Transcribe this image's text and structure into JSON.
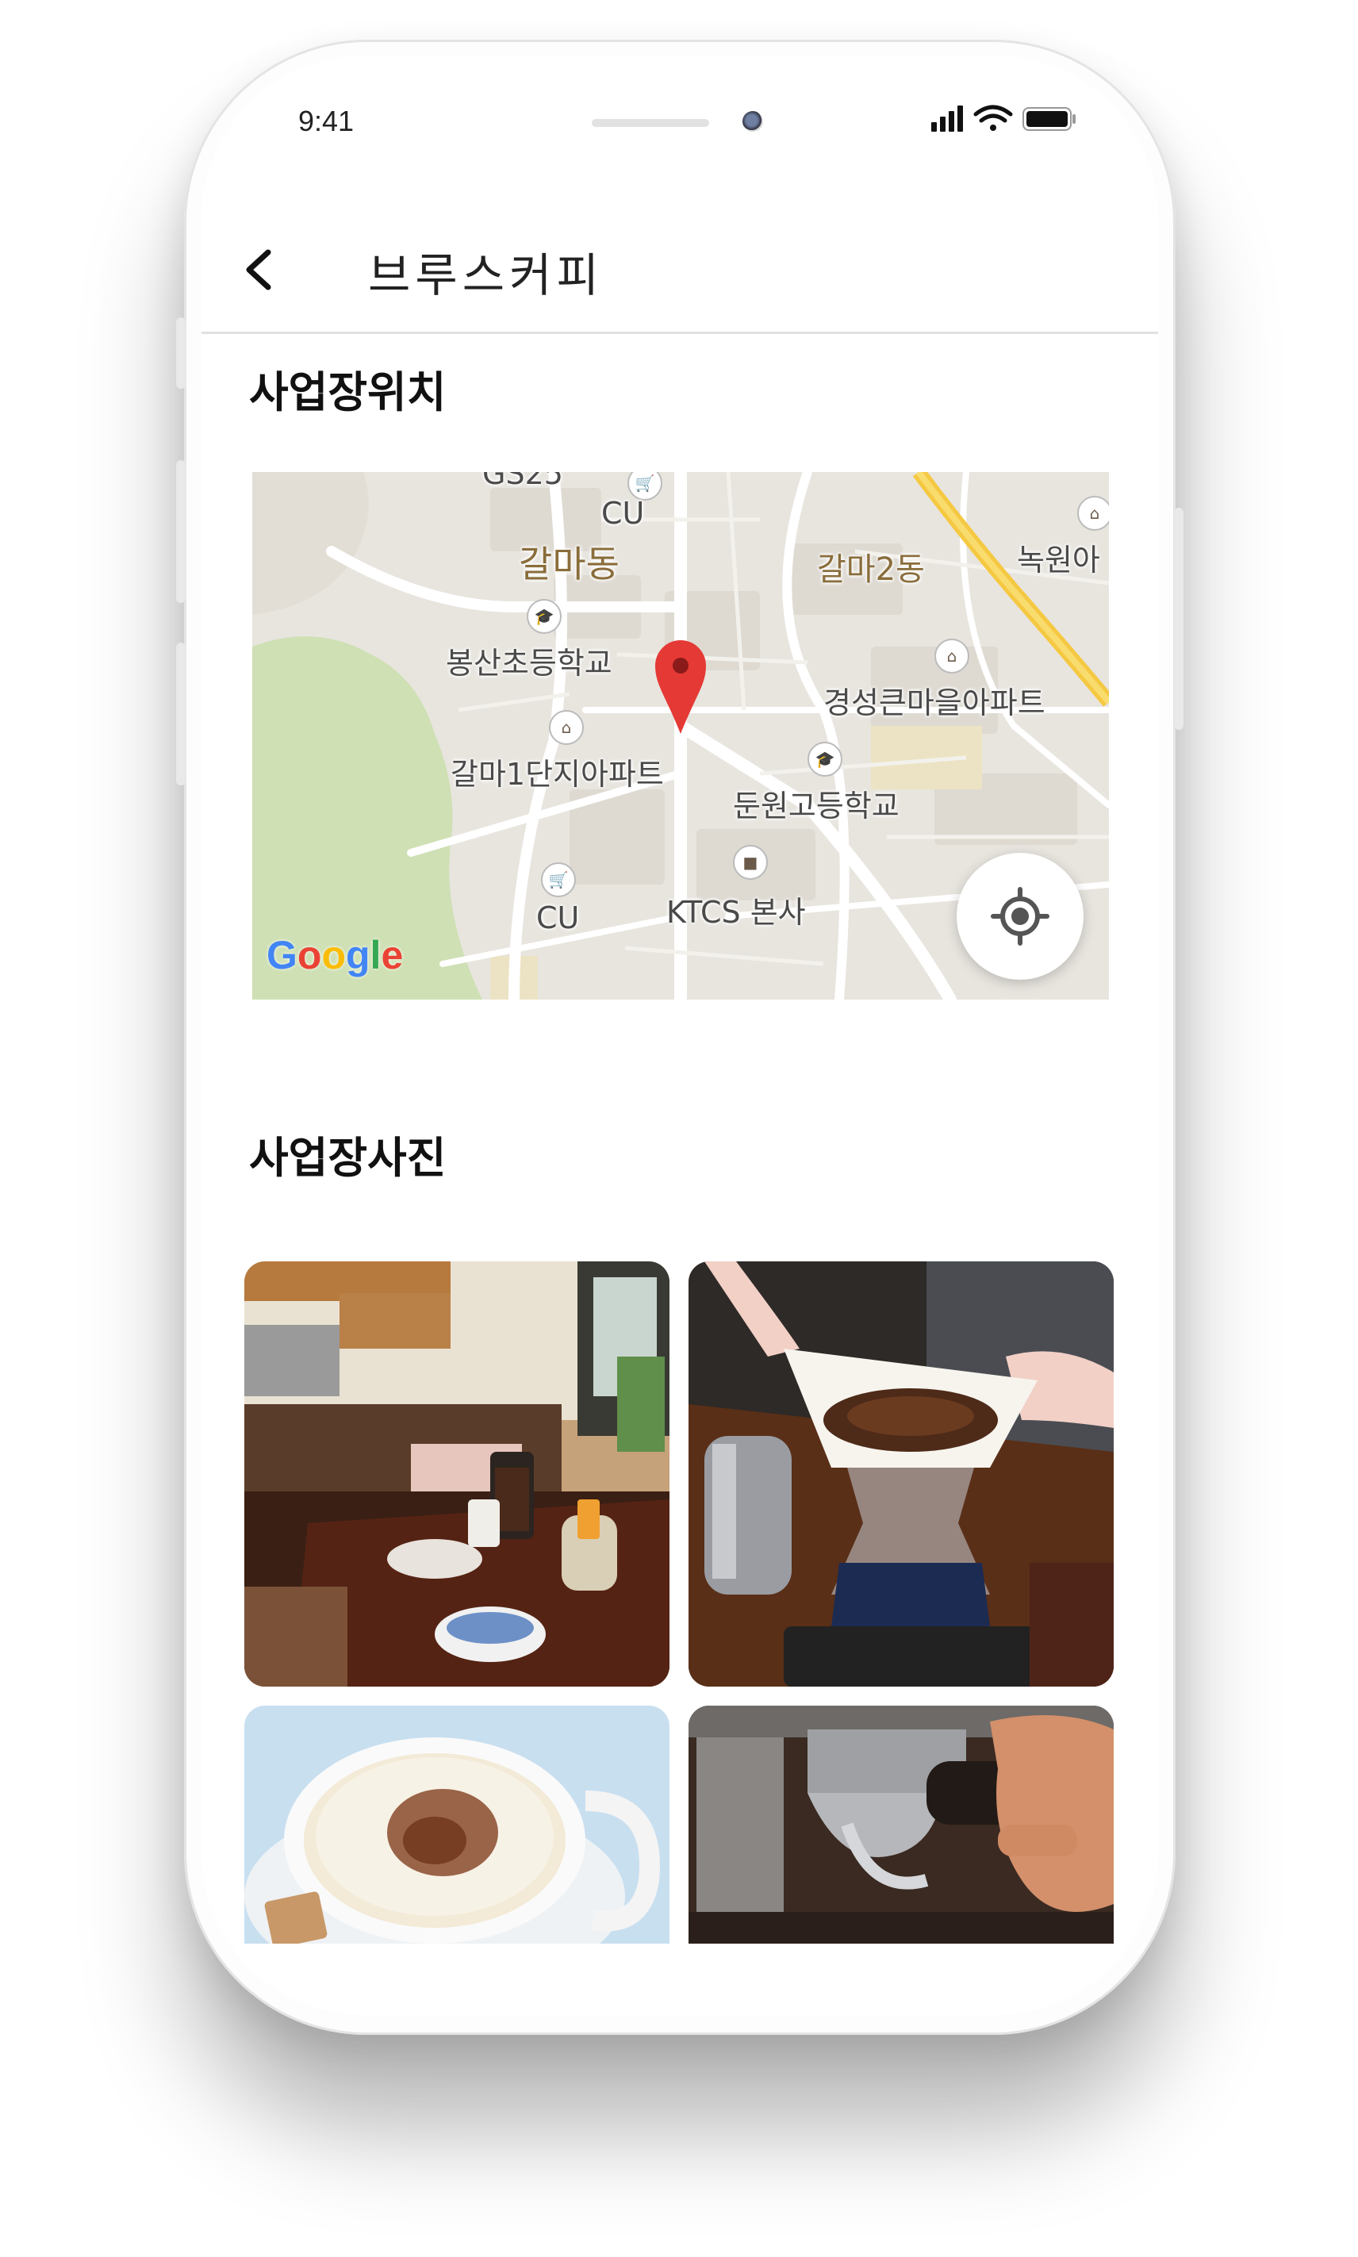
{
  "status_bar": {
    "time": "9:41"
  },
  "header": {
    "title": "브루스커피",
    "back_icon": "chevron-left-icon"
  },
  "location_section": {
    "title": "사업장위치"
  },
  "map": {
    "labels": {
      "gs25": "GS25",
      "cu_top": "CU",
      "galmadong": "갈마동",
      "galma2dong": "갈마2동",
      "nokwon": "녹원아",
      "bongsan_school": "봉산초등학교",
      "gyeongseong_apt": "경성큰마을아파트",
      "galma1_apt": "갈마1단지아파트",
      "dunwon_school": "둔원고등학교",
      "cu_bottom": "CU",
      "ktcs": "KTCS 본사"
    },
    "attribution": "Google",
    "pin_color": "#e53935",
    "locate_icon": "my-location-icon"
  },
  "photos_section": {
    "title": "사업장사진"
  },
  "photos": [
    {
      "id": "photo-1",
      "subject": "cafe-interior"
    },
    {
      "id": "photo-2",
      "subject": "pour-over"
    },
    {
      "id": "photo-3",
      "subject": "cappuccino"
    },
    {
      "id": "photo-4",
      "subject": "espresso-machine"
    }
  ]
}
